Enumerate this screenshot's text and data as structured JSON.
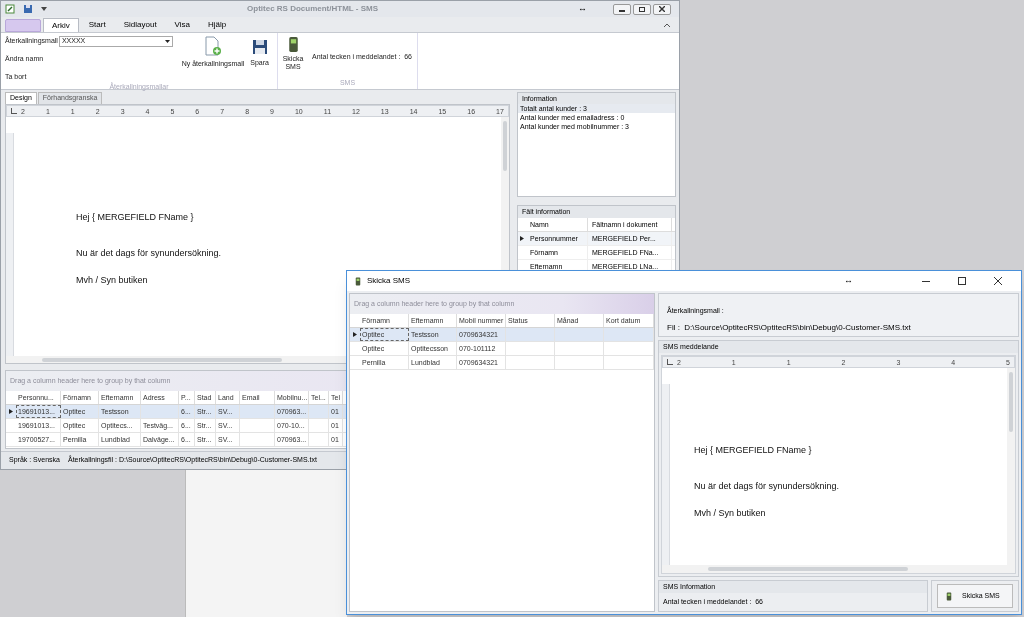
{
  "main_window": {
    "title": "Optitec RS Document/HTML - SMS",
    "resize_glyph": "↔",
    "ribbon_tabs": [
      {
        "label": "Arkiv",
        "selected": true
      },
      {
        "label": "Start",
        "selected": false
      },
      {
        "label": "Sidlayout",
        "selected": false
      },
      {
        "label": "Visa",
        "selected": false
      },
      {
        "label": "Hjälp",
        "selected": false
      }
    ],
    "ribbon": {
      "template_label": "Återkallningsmall",
      "template_value": "XXXXX",
      "rename": "Ändra namn",
      "delete": "Ta bort",
      "new_template": "Ny återkallningsmall",
      "save": "Spara",
      "group1_label": "Återkallningsmallar",
      "send_sms": "Skicka SMS",
      "char_count": "Antal tecken i meddelandet :  66",
      "group2_label": "SMS"
    },
    "doc_tabs": [
      {
        "label": "Design",
        "selected": true
      },
      {
        "label": "Förhandsgranska",
        "selected": false
      }
    ],
    "ruler_labels": [
      "2",
      "1",
      "1",
      "2",
      "3",
      "4",
      "5",
      "6",
      "7",
      "8",
      "9",
      "10",
      "11",
      "12",
      "13",
      "14",
      "15",
      "16",
      "17"
    ],
    "document": [
      "Hej { MERGEFIELD FName }",
      "Nu är det dags för synundersökning.",
      "Mvh / Syn butiken"
    ],
    "info_panel": {
      "title": "Information",
      "lines": [
        {
          "text": "Totalt antal kunder : 3",
          "selected": true
        },
        {
          "text": "Antal kunder med emailadress : 0",
          "selected": false
        },
        {
          "text": "Antal kunder med mobilnummer : 3",
          "selected": false
        }
      ]
    },
    "field_panel": {
      "title": "Fält information",
      "columns": [
        "Namn",
        "Fältnamn i dokument"
      ],
      "rows": [
        {
          "cells": [
            "Personnummer",
            "MERGEFIELD Per..."
          ],
          "selected": true
        },
        {
          "cells": [
            "Förnamn",
            "MERGEFIELD FNa..."
          ],
          "selected": false
        },
        {
          "cells": [
            "Efternamn",
            "MERGEFIELD LNa..."
          ],
          "selected": false
        }
      ]
    },
    "grid": {
      "group_hint": "Drag a column header here to group by that column",
      "columns": [
        "Personnu...",
        "Förnamn",
        "Efternamn",
        "Adress",
        "P...",
        "Stad",
        "Land",
        "Email",
        "Mobilnu...",
        "Tel...",
        "Tel"
      ],
      "rows": [
        {
          "cells": [
            "19691013...",
            "Optitec",
            "Testsson",
            null,
            "6...",
            "Str...",
            "SV...",
            null,
            "070963...",
            null,
            "01"
          ],
          "selected": true
        },
        {
          "cells": [
            "19691013...",
            "Optitec",
            "Optitecs...",
            "Testväg...",
            "6...",
            "Str...",
            "SV...",
            null,
            "070-10...",
            null,
            "01"
          ],
          "selected": false
        },
        {
          "cells": [
            "19700527...",
            "Pernilla",
            "Lundblad",
            "Dalväge...",
            "6...",
            "Str...",
            "SV...",
            null,
            "070963...",
            null,
            "01"
          ],
          "selected": false
        }
      ]
    },
    "status_bar": {
      "language": "Språk : Svenska",
      "file": "Återkallningsfil : D:\\Source\\OptitecRS\\OptitecRS\\bin\\Debug\\0-Customer-SMS.txt"
    }
  },
  "sms_dialog": {
    "title": "Skicka SMS",
    "resize_glyph": "↔",
    "grid": {
      "group_hint": "Drag a column header here to group by that column",
      "columns": [
        "Förnamn",
        "Efternamn",
        "Mobil nummer",
        "Status",
        "Månad",
        "Kort datum"
      ],
      "rows": [
        {
          "cells": [
            "Optitec",
            "Testsson",
            "0709634321",
            null,
            null,
            null
          ],
          "selected": true
        },
        {
          "cells": [
            "Optitec",
            "Optitecsson",
            "070-101112",
            null,
            null,
            null
          ],
          "selected": false
        },
        {
          "cells": [
            "Pernilla",
            "Lundblad",
            "0709634321",
            null,
            null,
            null
          ],
          "selected": false
        }
      ]
    },
    "template_label": "Återkallningsmall :",
    "file_line": "Fil :  D:\\Source\\OptitecRS\\OptitecRS\\bin\\Debug\\0-Customer-SMS.txt",
    "message_panel": {
      "title": "SMS meddelande",
      "ruler_labels": [
        "2",
        "1",
        "1",
        "2",
        "3",
        "4",
        "5"
      ],
      "document": [
        "Hej { MERGEFIELD FName }",
        "Nu är det dags för synundersökning.",
        "Mvh / Syn butiken"
      ]
    },
    "info_title": "SMS Information",
    "char_count": "Antal tecken i meddelandet :  66",
    "send_button": "Skicka SMS"
  }
}
